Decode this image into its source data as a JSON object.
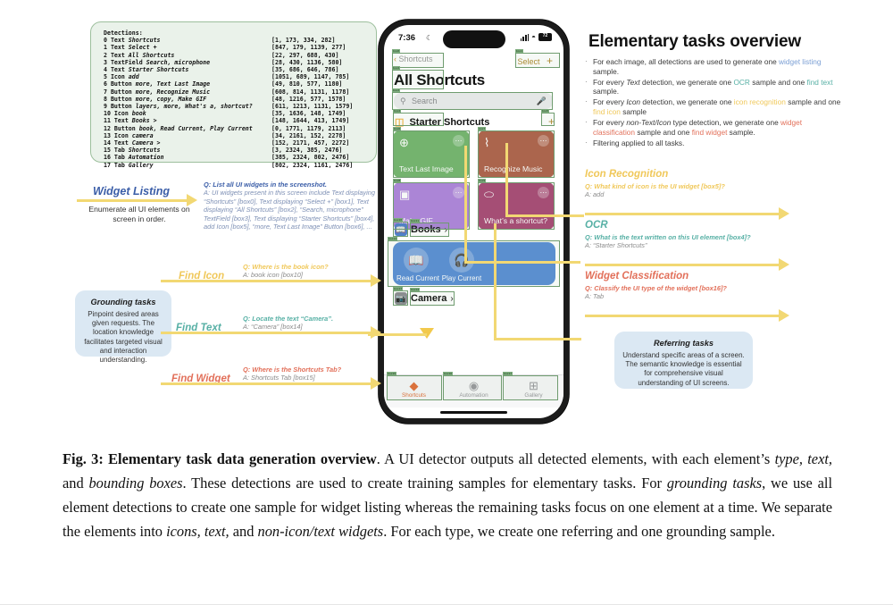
{
  "detections": {
    "title": "Detections:",
    "rows": [
      {
        "idx": "0",
        "type": "Text",
        "label": "Shortcuts",
        "box": "[1, 173, 334, 282]"
      },
      {
        "idx": "1",
        "type": "Text",
        "label": "Select +",
        "box": "[847, 179, 1139, 277]"
      },
      {
        "idx": "2",
        "type": "Text",
        "label": "All Shortcuts",
        "box": "[22, 297, 688, 430]"
      },
      {
        "idx": "3",
        "type": "TextField",
        "label": "Search, microphone",
        "box": "[28, 430, 1136, 580]"
      },
      {
        "idx": "4",
        "type": "Text",
        "label": "Starter Shortcuts",
        "box": "[35, 686, 646, 786]"
      },
      {
        "idx": "5",
        "type": "Icon",
        "label": "add",
        "box": "[1051, 689, 1147, 785]"
      },
      {
        "idx": "6",
        "type": "Button",
        "label": "more, Text Last Image",
        "box": "[49, 810, 577, 1180]"
      },
      {
        "idx": "7",
        "type": "Button",
        "label": "more, Recognize Music",
        "box": "[608, 814, 1131, 1178]"
      },
      {
        "idx": "8",
        "type": "Button",
        "label": "more, copy, Make GIF",
        "box": "[48, 1216, 577, 1578]"
      },
      {
        "idx": "9",
        "type": "Button",
        "label": "layers, more, What's a, shortcut?",
        "box": "[611, 1213, 1131, 1579]"
      },
      {
        "idx": "10",
        "type": "Icon",
        "label": "book",
        "box": "[35, 1636, 148, 1749]"
      },
      {
        "idx": "11",
        "type": "Text",
        "label": "Books >",
        "box": "[148, 1644, 413, 1749]"
      },
      {
        "idx": "12",
        "type": "Button",
        "label": "book, Read Current, Play Current",
        "box": "[0, 1771, 1179, 2113]"
      },
      {
        "idx": "13",
        "type": "Icon",
        "label": "camera",
        "box": "[34, 2161, 152, 2278]"
      },
      {
        "idx": "14",
        "type": "Text",
        "label": "Camera >",
        "box": "[152, 2171, 457, 2272]"
      },
      {
        "idx": "15",
        "type": "Tab",
        "label": "Shortcuts",
        "box": "[3, 2324, 385, 2476]"
      },
      {
        "idx": "16",
        "type": "Tab",
        "label": "Automation",
        "box": "[385, 2324, 802, 2476]"
      },
      {
        "idx": "17",
        "type": "Tab",
        "label": "Gallery",
        "box": "[802, 2324, 1161, 2476]"
      }
    ]
  },
  "widget_listing": {
    "label": "Widget Listing",
    "desc": "Enumerate all UI elements on screen in order.",
    "q": "Q: List all UI widgets in the screenshot.",
    "a": "A: UI widgets present in this screen include Text displaying “Shortcuts” [box0], Text displaying “Select +” [box1], Text displaying “All Shortcuts” [box2], “Search, microphone” TextField [box3], Text displaying “Starter Shortcuts” [box4], add Icon [box5], “more, Text Last Image” Button [box6], ..."
  },
  "grounding_box": {
    "title": "Grounding tasks",
    "body": "Pinpoint desired areas given requests. The location knowledge facilitates targeted visual and interaction understanding."
  },
  "referring_box": {
    "title": "Referring tasks",
    "body": "Understand specific areas of a screen. The semantic knowledge is essential for comprehensive visual understanding of UI screens."
  },
  "grounding_tasks": [
    {
      "label": "Find Icon",
      "q": "Q: Where is the book icon?",
      "a": "A: book icon [box10]",
      "color": "#f0c85a"
    },
    {
      "label": "Find Text",
      "q": "Q: Locate the text “Camera”.",
      "a": "A: “Camera” [box14]",
      "color": "#57b0a5"
    },
    {
      "label": "Find Widget",
      "q": "Q: Where is the Shortcuts Tab?",
      "a": "A: Shortcuts Tab [box15]",
      "color": "#e2705a"
    }
  ],
  "referring_tasks": [
    {
      "label": "Icon Recognition",
      "q": "Q: What kind of icon is the UI widget [box5]?",
      "a": "A: add",
      "color": "#f0c85a"
    },
    {
      "label": "OCR",
      "q": "Q: What is the text written on this UI element [box4]?",
      "a": "A: “Starter Shortcuts”",
      "color": "#57b0a5"
    },
    {
      "label": "Widget Classification",
      "q": "Q: Classify the UI type of the widget [box16]?",
      "a": "A: Tab",
      "color": "#e2705a"
    }
  ],
  "overview": {
    "title": "Elementary tasks overview",
    "bullets": [
      {
        "parts": [
          {
            "t": "For each image, all detections are used to generate one "
          },
          {
            "t": "widget listing",
            "c": "c-wl"
          },
          {
            "t": " sample."
          }
        ]
      },
      {
        "parts": [
          {
            "t": "For every "
          },
          {
            "t": "Text",
            "i": true
          },
          {
            "t": " detection, we generate one "
          },
          {
            "t": "OCR",
            "c": "c-ocr"
          },
          {
            "t": " sample and one "
          },
          {
            "t": "find text",
            "c": "c-ft"
          },
          {
            "t": " sample."
          }
        ]
      },
      {
        "parts": [
          {
            "t": "For every "
          },
          {
            "t": "Icon",
            "i": true
          },
          {
            "t": " detection, we generate one "
          },
          {
            "t": "icon recognition",
            "c": "c-ir"
          },
          {
            "t": " sample and one "
          },
          {
            "t": "find icon",
            "c": "c-fi"
          },
          {
            "t": " sample"
          }
        ]
      },
      {
        "parts": [
          {
            "t": "For every "
          },
          {
            "t": "non-Text/Icon",
            "i": true
          },
          {
            "t": " type detection, we generate one "
          },
          {
            "t": "widget classification",
            "c": "c-wc"
          },
          {
            "t": " sample and one "
          },
          {
            "t": "find widget",
            "c": "c-fw"
          },
          {
            "t": " sample."
          }
        ]
      },
      {
        "parts": [
          {
            "t": "Filtering applied to all tasks."
          }
        ]
      }
    ]
  },
  "phone": {
    "status": {
      "time": "7:36",
      "moon": "☾",
      "battery": "72"
    },
    "nav": {
      "back": "Shortcuts",
      "select": "Select",
      "plus": "+"
    },
    "title": "All Shortcuts",
    "search": {
      "placeholder": "Search",
      "icon": "search-icon",
      "mic": "microphone-icon"
    },
    "section": {
      "label": "Starter Shortcuts",
      "plus": "+"
    },
    "cards": [
      {
        "label": "Text Last Image",
        "color": "#75b56f",
        "icon": "⊕"
      },
      {
        "label": "Recognize Music",
        "color": "#b0624c",
        "icon": "⌇"
      },
      {
        "label": "Make GIF",
        "color": "#b084dd",
        "icon": "▣"
      },
      {
        "label": "What’s a shortcut?",
        "color": "#a94a76",
        "icon": "⬭"
      }
    ],
    "rows": [
      {
        "label": "Books",
        "chev": "›",
        "icon": "📘",
        "bg": "#4e7fd0"
      },
      {
        "label": "Camera",
        "chev": "›",
        "icon": "📷",
        "bg": "#8e8e93"
      }
    ],
    "blue_buttons": [
      {
        "label": "Read Current",
        "icon": "📖"
      },
      {
        "label": "Play Current",
        "icon": "🎧"
      }
    ],
    "tabs": [
      {
        "label": "Shortcuts",
        "icon": "◆",
        "active": true
      },
      {
        "label": "Automation",
        "icon": "◉",
        "active": false
      },
      {
        "label": "Gallery",
        "icon": "⊞",
        "active": false
      }
    ]
  },
  "caption": {
    "figno": "Fig. 3: ",
    "bold": "Elementary task data generation overview",
    "rest": ". A UI detector outputs all detected elements, with each element’s ",
    "i1": "type, text,",
    "r2": " and ",
    "i2": "bounding boxes",
    "r3": ". These detections are used to create training samples for elementary tasks. For ",
    "i3": "grounding tasks",
    "r4": ", we use all element detections to create one sample for widget listing whereas the remaining tasks focus on one element at a time. We separate the elements into ",
    "i4": "icons, text,",
    "r5": " and ",
    "i5": "non-icon/text widgets",
    "r6": ". For each type, we create one referring and one grounding sample."
  }
}
